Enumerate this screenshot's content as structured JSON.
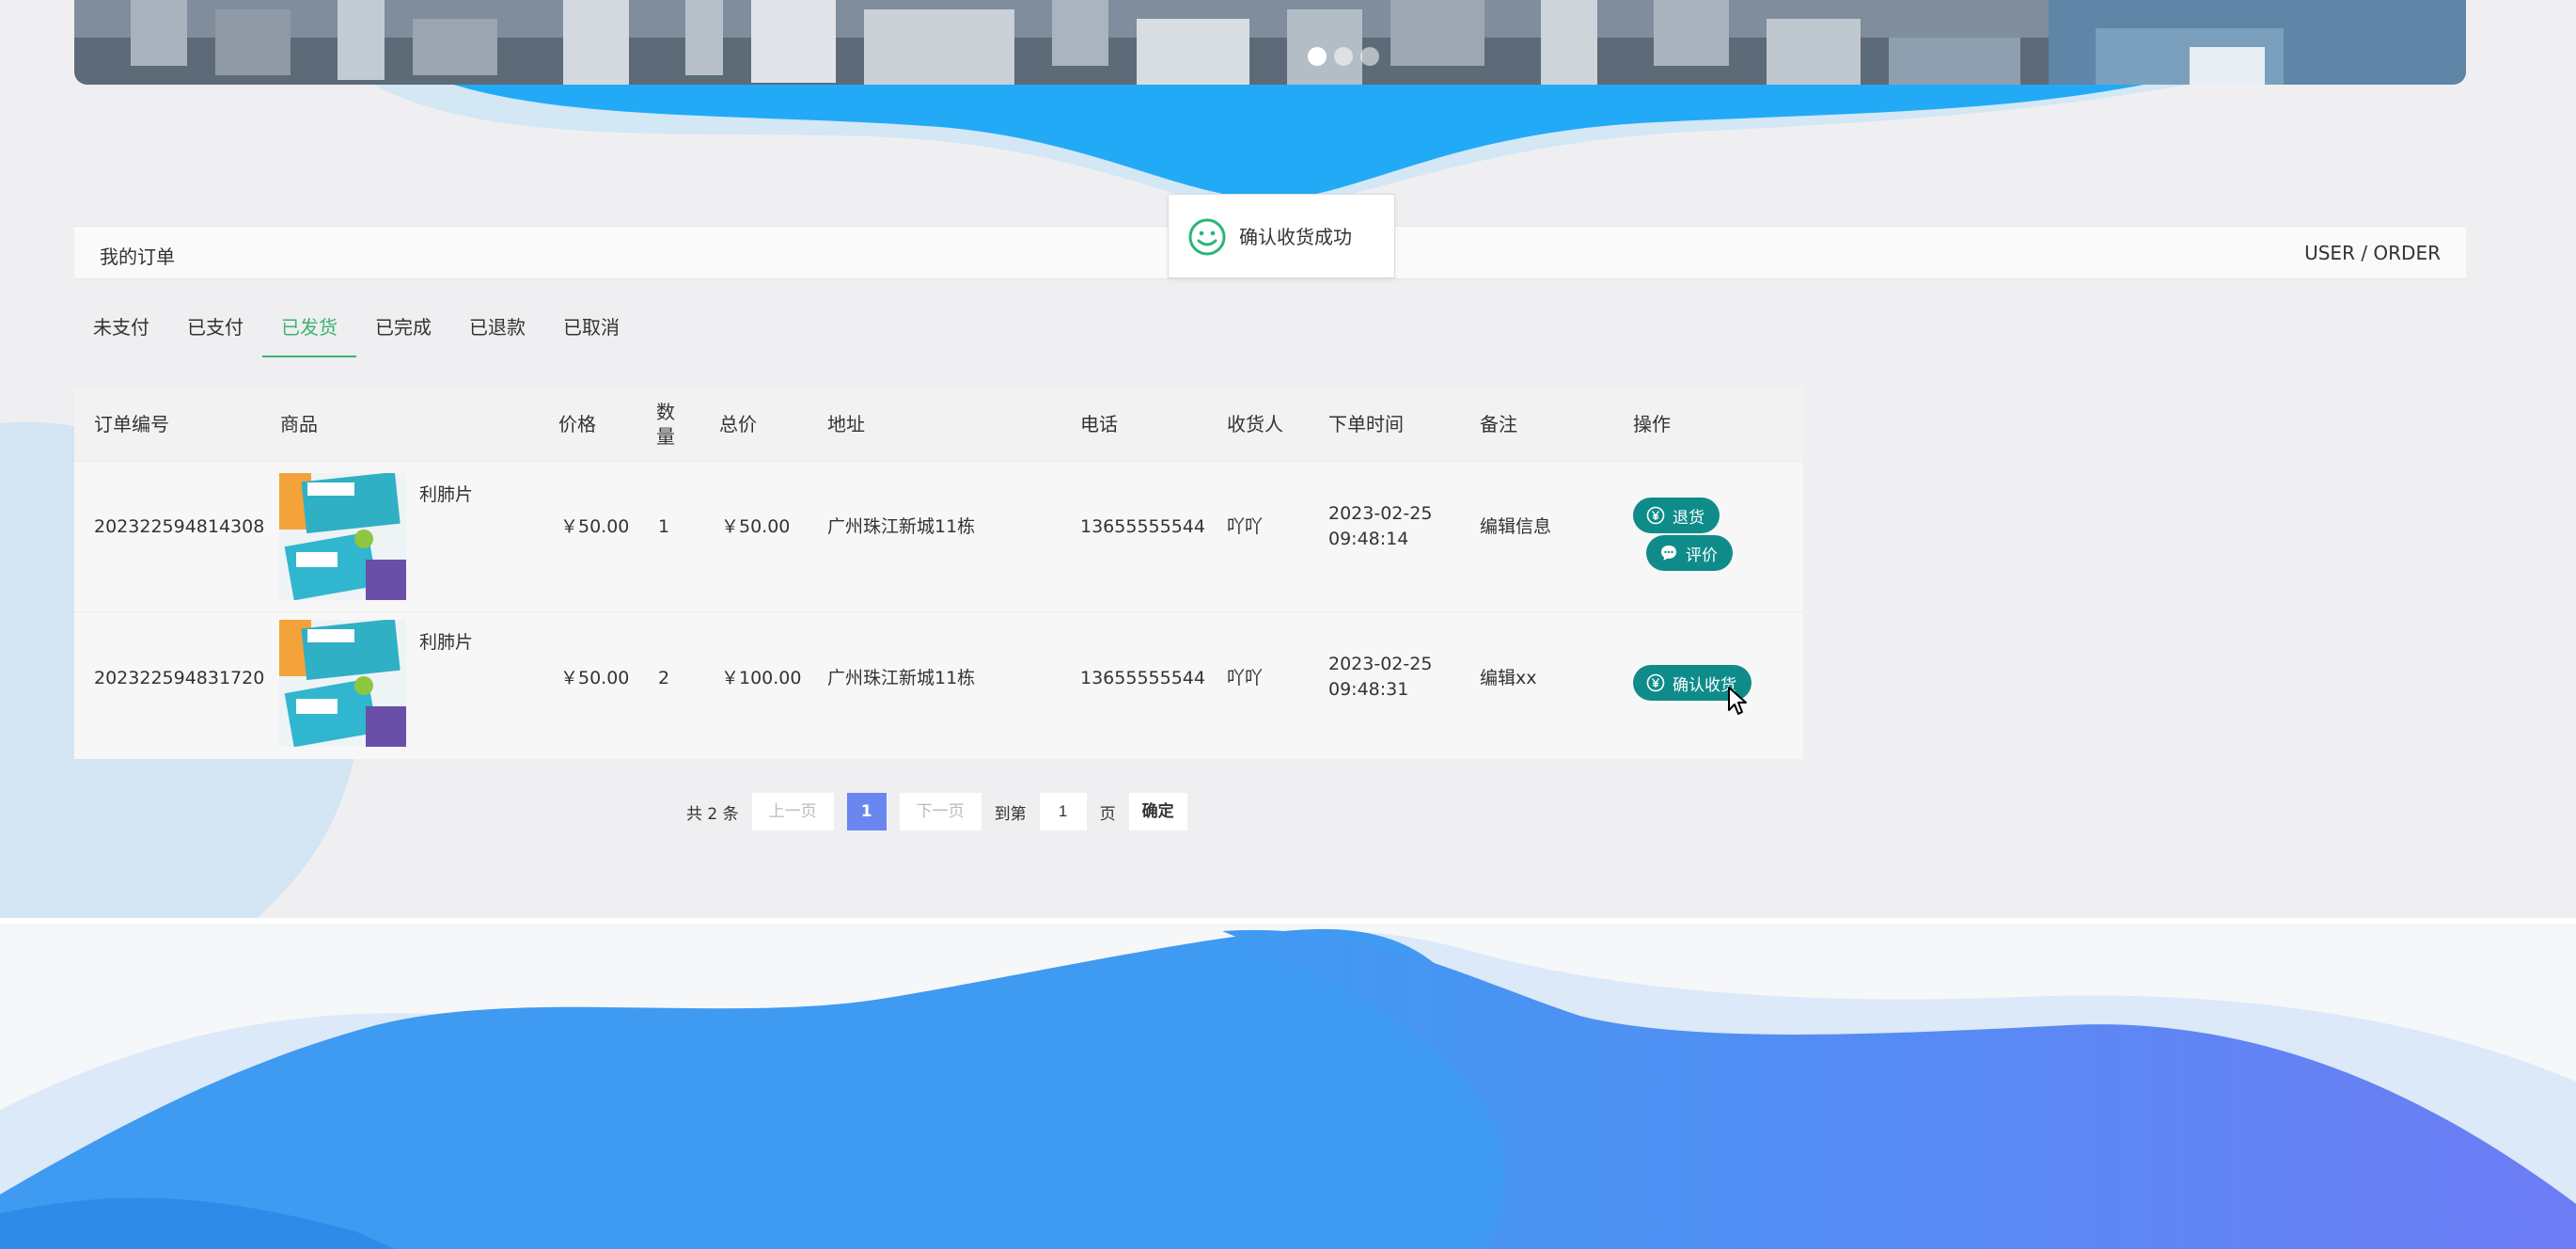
{
  "banner": {
    "dots": 3,
    "active_dot": 0
  },
  "header": {
    "title": "我的订单",
    "breadcrumb": "USER / ORDER"
  },
  "toast": {
    "message": "确认收货成功"
  },
  "tabs": [
    "未支付",
    "已支付",
    "已发货",
    "已完成",
    "已退款",
    "已取消"
  ],
  "active_tab": 2,
  "table": {
    "headers": [
      "订单编号",
      "商品",
      "价格",
      "数\n量",
      "总价",
      "地址",
      "电话",
      "收货人",
      "下单时间",
      "备注",
      "操作"
    ],
    "rows": [
      {
        "order_no": "202322594814308",
        "product": "利肺片",
        "price": "￥50.00",
        "qty": "1",
        "total": "￥50.00",
        "address": "广州珠江新城11栋",
        "phone": "13655555544",
        "receiver": "吖吖",
        "time_date": "2023-02-25",
        "time_clock": "09:48:14",
        "remark": "编辑信息",
        "actions": [
          "退货",
          "评价"
        ]
      },
      {
        "order_no": "202322594831720",
        "product": "利肺片",
        "price": "￥50.00",
        "qty": "2",
        "total": "￥100.00",
        "address": "广州珠江新城11栋",
        "phone": "13655555544",
        "receiver": "吖吖",
        "time_date": "2023-02-25",
        "time_clock": "09:48:31",
        "remark": "编辑xx",
        "actions": [
          "确认收货"
        ]
      }
    ]
  },
  "pagination": {
    "total": "共 2 条",
    "prev": "上一页",
    "current": "1",
    "next": "下一页",
    "goto_label": "到第",
    "goto_value": "1",
    "page_unit": "页",
    "confirm": "确定"
  },
  "colors": {
    "accent": "#0f8c8a",
    "tab_active": "#3cb371",
    "page_current": "#6a86f1",
    "wave_blue": "#2aa8f8"
  }
}
